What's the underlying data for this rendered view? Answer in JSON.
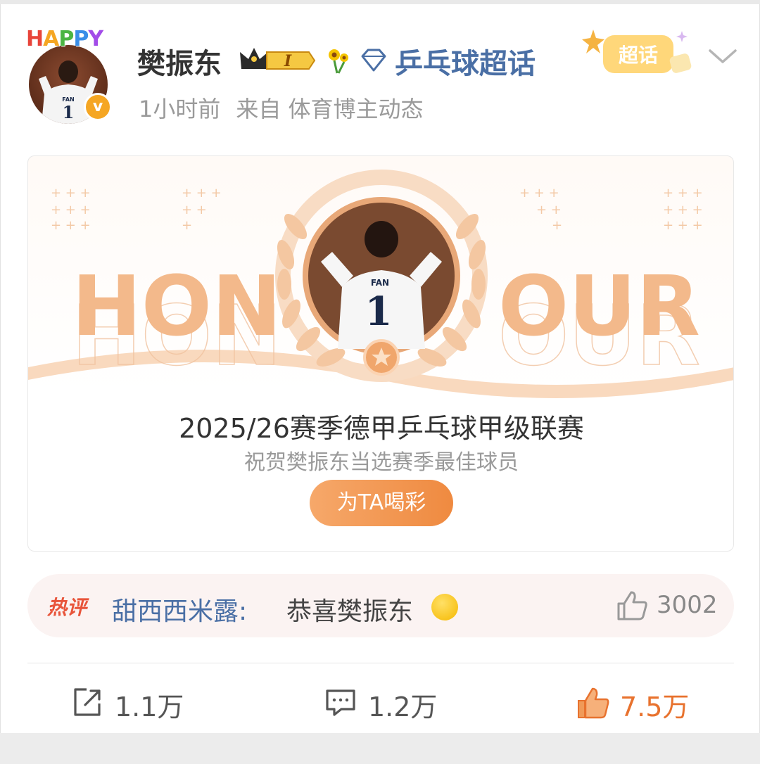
{
  "post": {
    "avatar_badge_text": "HAPPY",
    "username": "樊振东",
    "level_badge": "I",
    "topic": "乒乓球超话",
    "supertopic_badge": "超话",
    "time": "1小时前",
    "source": "来自 体育博主动态"
  },
  "banner": {
    "honour_left": "HON",
    "honour_right": "OUR",
    "jersey_name": "FAN",
    "jersey_number": "1",
    "title": "2025/26赛季德甲乒乓球甲级联赛",
    "subtitle": "祝贺樊振东当选赛季最佳球员",
    "cheer_button": "为TA喝彩"
  },
  "hot_comment": {
    "tag": "热评",
    "user": "甜西西米露:",
    "text": "恭喜樊振东",
    "likes": "3002"
  },
  "actions": {
    "repost": "1.1万",
    "comment": "1.2万",
    "like": "7.5万"
  },
  "colors": {
    "accent_orange": "#ef8a40",
    "link_blue": "#4a6fa5",
    "honour_peach": "#f3b98b"
  },
  "icons": [
    "crown-icon",
    "sunflower-icon",
    "diamond-icon",
    "chevron-down-icon",
    "thumbs-up-icon",
    "repost-icon",
    "comment-icon",
    "verified-icon"
  ]
}
